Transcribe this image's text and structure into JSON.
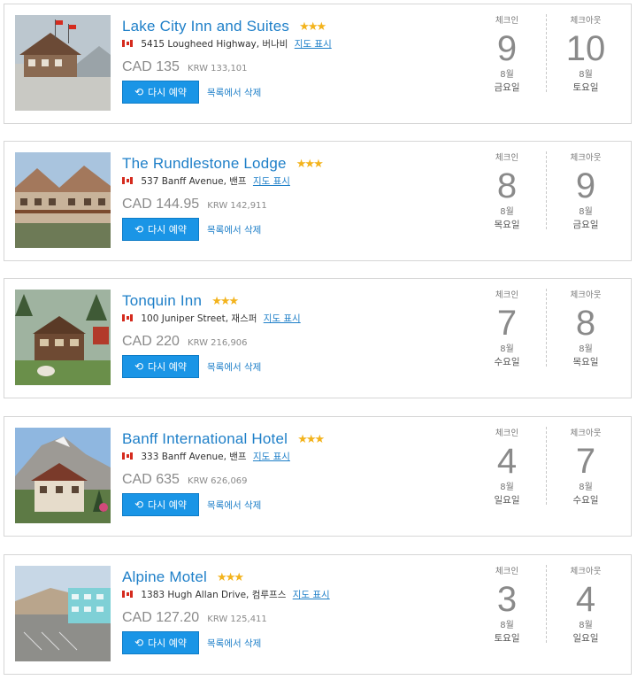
{
  "labels": {
    "checkin": "체크인",
    "checkout": "체크아웃",
    "rebook": "다시 예약",
    "remove": "목록에서 삭제",
    "map": "지도 표시",
    "stars": "★★★"
  },
  "colors": {
    "link": "#1e7fc8",
    "button": "#1a95e6",
    "star": "#f3b31c",
    "muted": "#8a8a8a"
  },
  "hotels": [
    {
      "name": "Lake City Inn and Suites",
      "address": "5415 Lougheed Highway, 버나비",
      "price": "CAD 135",
      "price_krw": "KRW 133,101",
      "checkin_day": "9",
      "checkin_month": "8월",
      "checkin_weekday": "금요일",
      "checkout_day": "10",
      "checkout_month": "8월",
      "checkout_weekday": "토요일"
    },
    {
      "name": "The Rundlestone Lodge",
      "address": "537 Banff Avenue, 밴프",
      "price": "CAD 144.95",
      "price_krw": "KRW 142,911",
      "checkin_day": "8",
      "checkin_month": "8월",
      "checkin_weekday": "목요일",
      "checkout_day": "9",
      "checkout_month": "8월",
      "checkout_weekday": "금요일"
    },
    {
      "name": "Tonquin Inn",
      "address": "100 Juniper Street, 재스퍼",
      "price": "CAD 220",
      "price_krw": "KRW 216,906",
      "checkin_day": "7",
      "checkin_month": "8월",
      "checkin_weekday": "수요일",
      "checkout_day": "8",
      "checkout_month": "8월",
      "checkout_weekday": "목요일"
    },
    {
      "name": "Banff International Hotel",
      "address": "333 Banff Avenue, 밴프",
      "price": "CAD 635",
      "price_krw": "KRW 626,069",
      "checkin_day": "4",
      "checkin_month": "8월",
      "checkin_weekday": "일요일",
      "checkout_day": "7",
      "checkout_month": "8월",
      "checkout_weekday": "수요일"
    },
    {
      "name": "Alpine Motel",
      "address": "1383 Hugh Allan Drive, 컴루프스",
      "price": "CAD 127.20",
      "price_krw": "KRW 125,411",
      "checkin_day": "3",
      "checkin_month": "8월",
      "checkin_weekday": "토요일",
      "checkout_day": "4",
      "checkout_month": "8월",
      "checkout_weekday": "일요일"
    }
  ]
}
